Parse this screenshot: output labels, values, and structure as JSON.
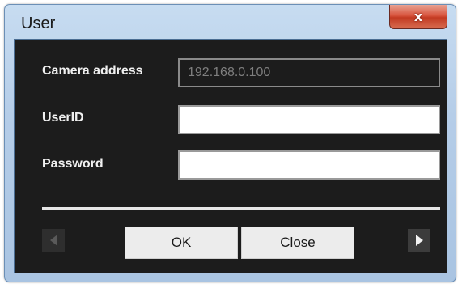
{
  "window": {
    "title": "User",
    "close_glyph": "x"
  },
  "fields": {
    "camera_address": {
      "label": "Camera address",
      "value": "192.168.0.100"
    },
    "user_id": {
      "label": "UserID",
      "value": ""
    },
    "password": {
      "label": "Password",
      "value": ""
    }
  },
  "buttons": {
    "ok_label": "OK",
    "close_label": "Close"
  },
  "icons": {
    "prev": "arrow-left-icon",
    "next": "arrow-right-icon"
  },
  "colors": {
    "client_background": "#1c1c1c",
    "title_bar": "#b5cde8",
    "close_button": "#c23a22"
  }
}
